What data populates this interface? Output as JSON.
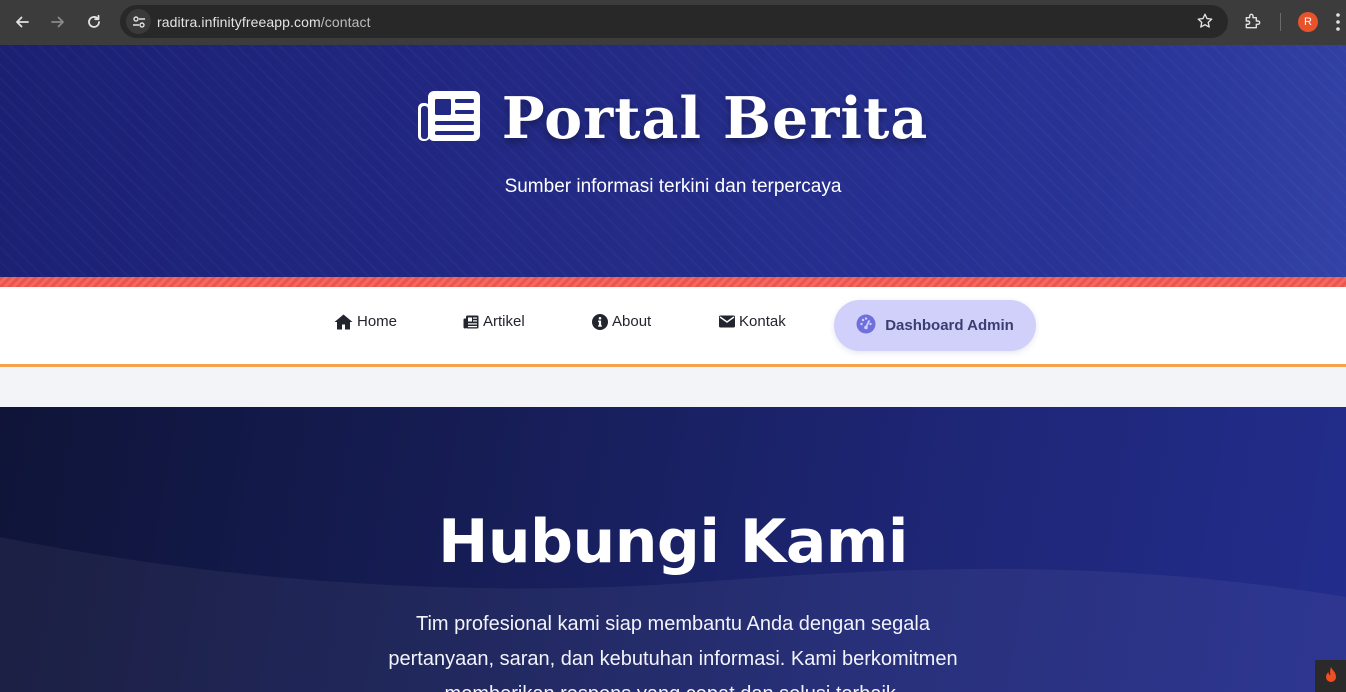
{
  "browser": {
    "url_host": "raditra.infinityfreeapp.com",
    "url_path": "/contact",
    "profile_initial": "R"
  },
  "header": {
    "title": "Portal Berita",
    "tagline": "Sumber informasi terkini dan terpercaya",
    "logo_icon": "newspaper-icon"
  },
  "nav": {
    "items": [
      {
        "label": "Home",
        "icon": "home-icon"
      },
      {
        "label": "Artikel",
        "icon": "newspaper-icon"
      },
      {
        "label": "About",
        "icon": "info-icon"
      },
      {
        "label": "Kontak",
        "icon": "envelope-icon"
      }
    ],
    "dashboard_label": "Dashboard Admin",
    "dashboard_icon": "gauge-icon"
  },
  "hero": {
    "title": "Hubungi Kami",
    "text": "Tim profesional kami siap membantu Anda dengan segala pertanyaan, saran, dan kebutuhan informasi. Kami berkomitmen memberikan respons yang cepat dan solusi terbaik."
  },
  "colors": {
    "header_bg": "#232a86",
    "accent_stripe": "#ef5350",
    "nav_border": "#f5a34a",
    "dashboard_btn": "#d0d0fb",
    "hero_bg": "#161d55"
  }
}
